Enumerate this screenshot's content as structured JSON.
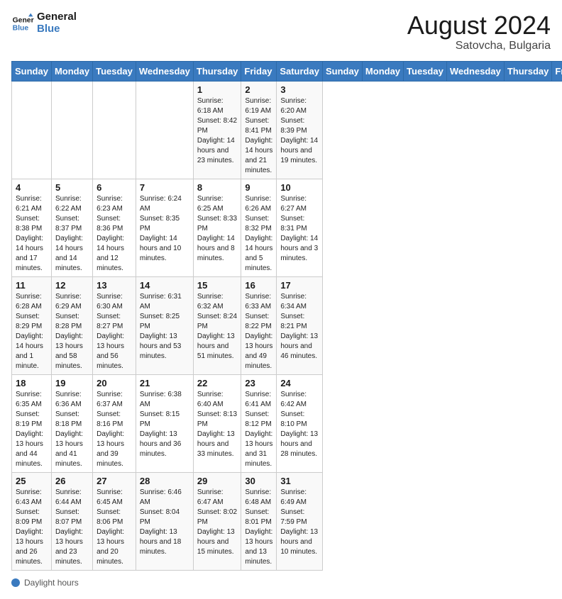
{
  "header": {
    "logo_line1": "General",
    "logo_line2": "Blue",
    "month_year": "August 2024",
    "location": "Satovcha, Bulgaria"
  },
  "footer": {
    "label": "Daylight hours"
  },
  "days_of_week": [
    "Sunday",
    "Monday",
    "Tuesday",
    "Wednesday",
    "Thursday",
    "Friday",
    "Saturday"
  ],
  "weeks": [
    [
      {
        "day": "",
        "info": ""
      },
      {
        "day": "",
        "info": ""
      },
      {
        "day": "",
        "info": ""
      },
      {
        "day": "",
        "info": ""
      },
      {
        "day": "1",
        "info": "Sunrise: 6:18 AM\nSunset: 8:42 PM\nDaylight: 14 hours and 23 minutes."
      },
      {
        "day": "2",
        "info": "Sunrise: 6:19 AM\nSunset: 8:41 PM\nDaylight: 14 hours and 21 minutes."
      },
      {
        "day": "3",
        "info": "Sunrise: 6:20 AM\nSunset: 8:39 PM\nDaylight: 14 hours and 19 minutes."
      }
    ],
    [
      {
        "day": "4",
        "info": "Sunrise: 6:21 AM\nSunset: 8:38 PM\nDaylight: 14 hours and 17 minutes."
      },
      {
        "day": "5",
        "info": "Sunrise: 6:22 AM\nSunset: 8:37 PM\nDaylight: 14 hours and 14 minutes."
      },
      {
        "day": "6",
        "info": "Sunrise: 6:23 AM\nSunset: 8:36 PM\nDaylight: 14 hours and 12 minutes."
      },
      {
        "day": "7",
        "info": "Sunrise: 6:24 AM\nSunset: 8:35 PM\nDaylight: 14 hours and 10 minutes."
      },
      {
        "day": "8",
        "info": "Sunrise: 6:25 AM\nSunset: 8:33 PM\nDaylight: 14 hours and 8 minutes."
      },
      {
        "day": "9",
        "info": "Sunrise: 6:26 AM\nSunset: 8:32 PM\nDaylight: 14 hours and 5 minutes."
      },
      {
        "day": "10",
        "info": "Sunrise: 6:27 AM\nSunset: 8:31 PM\nDaylight: 14 hours and 3 minutes."
      }
    ],
    [
      {
        "day": "11",
        "info": "Sunrise: 6:28 AM\nSunset: 8:29 PM\nDaylight: 14 hours and 1 minute."
      },
      {
        "day": "12",
        "info": "Sunrise: 6:29 AM\nSunset: 8:28 PM\nDaylight: 13 hours and 58 minutes."
      },
      {
        "day": "13",
        "info": "Sunrise: 6:30 AM\nSunset: 8:27 PM\nDaylight: 13 hours and 56 minutes."
      },
      {
        "day": "14",
        "info": "Sunrise: 6:31 AM\nSunset: 8:25 PM\nDaylight: 13 hours and 53 minutes."
      },
      {
        "day": "15",
        "info": "Sunrise: 6:32 AM\nSunset: 8:24 PM\nDaylight: 13 hours and 51 minutes."
      },
      {
        "day": "16",
        "info": "Sunrise: 6:33 AM\nSunset: 8:22 PM\nDaylight: 13 hours and 49 minutes."
      },
      {
        "day": "17",
        "info": "Sunrise: 6:34 AM\nSunset: 8:21 PM\nDaylight: 13 hours and 46 minutes."
      }
    ],
    [
      {
        "day": "18",
        "info": "Sunrise: 6:35 AM\nSunset: 8:19 PM\nDaylight: 13 hours and 44 minutes."
      },
      {
        "day": "19",
        "info": "Sunrise: 6:36 AM\nSunset: 8:18 PM\nDaylight: 13 hours and 41 minutes."
      },
      {
        "day": "20",
        "info": "Sunrise: 6:37 AM\nSunset: 8:16 PM\nDaylight: 13 hours and 39 minutes."
      },
      {
        "day": "21",
        "info": "Sunrise: 6:38 AM\nSunset: 8:15 PM\nDaylight: 13 hours and 36 minutes."
      },
      {
        "day": "22",
        "info": "Sunrise: 6:40 AM\nSunset: 8:13 PM\nDaylight: 13 hours and 33 minutes."
      },
      {
        "day": "23",
        "info": "Sunrise: 6:41 AM\nSunset: 8:12 PM\nDaylight: 13 hours and 31 minutes."
      },
      {
        "day": "24",
        "info": "Sunrise: 6:42 AM\nSunset: 8:10 PM\nDaylight: 13 hours and 28 minutes."
      }
    ],
    [
      {
        "day": "25",
        "info": "Sunrise: 6:43 AM\nSunset: 8:09 PM\nDaylight: 13 hours and 26 minutes."
      },
      {
        "day": "26",
        "info": "Sunrise: 6:44 AM\nSunset: 8:07 PM\nDaylight: 13 hours and 23 minutes."
      },
      {
        "day": "27",
        "info": "Sunrise: 6:45 AM\nSunset: 8:06 PM\nDaylight: 13 hours and 20 minutes."
      },
      {
        "day": "28",
        "info": "Sunrise: 6:46 AM\nSunset: 8:04 PM\nDaylight: 13 hours and 18 minutes."
      },
      {
        "day": "29",
        "info": "Sunrise: 6:47 AM\nSunset: 8:02 PM\nDaylight: 13 hours and 15 minutes."
      },
      {
        "day": "30",
        "info": "Sunrise: 6:48 AM\nSunset: 8:01 PM\nDaylight: 13 hours and 13 minutes."
      },
      {
        "day": "31",
        "info": "Sunrise: 6:49 AM\nSunset: 7:59 PM\nDaylight: 13 hours and 10 minutes."
      }
    ]
  ]
}
